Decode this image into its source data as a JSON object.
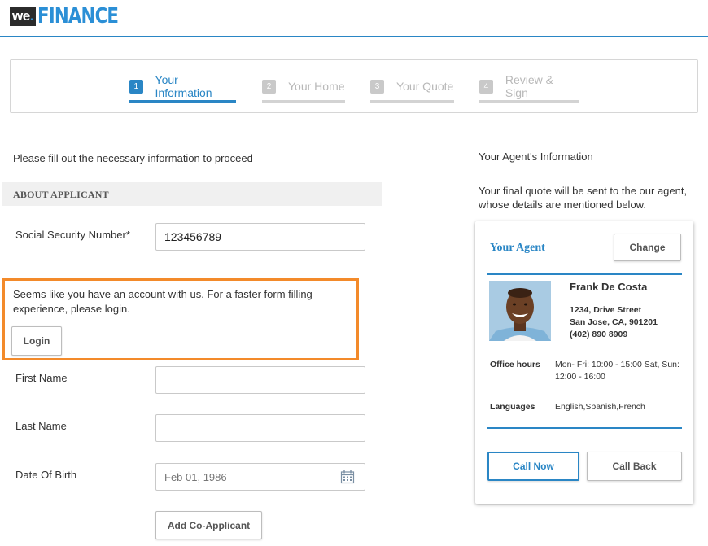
{
  "brand": {
    "logo_we": "we",
    "logo_dot": ".",
    "logo_finance": "FINANCE"
  },
  "steps": [
    {
      "num": "1",
      "label": "Your Information",
      "active": true
    },
    {
      "num": "2",
      "label": "Your Home",
      "active": false
    },
    {
      "num": "3",
      "label": "Your Quote",
      "active": false
    },
    {
      "num": "4",
      "label": "Review & Sign",
      "active": false
    }
  ],
  "form": {
    "intro": "Please fill out the necessary information to proceed",
    "section_title": "ABOUT APPLICANT",
    "ssn_label": "Social Security Number*",
    "ssn_value": "123456789",
    "login_notice": "Seems like you have an account with us. For a faster form filling experience, please login.",
    "login_button": "Login",
    "first_name_label": "First Name",
    "first_name_value": "",
    "last_name_label": "Last Name",
    "last_name_value": "",
    "dob_label": "Date Of Birth",
    "dob_value": "Feb 01, 1986",
    "add_co_applicant": "Add Co-Applicant"
  },
  "agent": {
    "heading": "Your Agent's Information",
    "description": "Your final quote will be sent to the our agent, whose details are mentioned below.",
    "card_title": "Your Agent",
    "change_button": "Change",
    "name": "Frank De Costa",
    "address_line1": "1234, Drive Street",
    "address_line2": "San Jose, CA, 901201",
    "phone": "(402) 890 8909",
    "office_hours_label": "Office hours",
    "office_hours_value": "Mon- Fri: 10:00 - 15:00 Sat, Sun: 12:00 - 16:00",
    "languages_label": "Languages",
    "languages_value": "English,Spanish,French",
    "call_now": "Call Now",
    "call_back": "Call Back"
  },
  "colors": {
    "accent": "#2a86c5",
    "highlight_border": "#f38a2a",
    "inactive": "#c9c9c9"
  },
  "icons": {
    "date": "calendar-icon",
    "agent_photo": "agent-avatar"
  }
}
